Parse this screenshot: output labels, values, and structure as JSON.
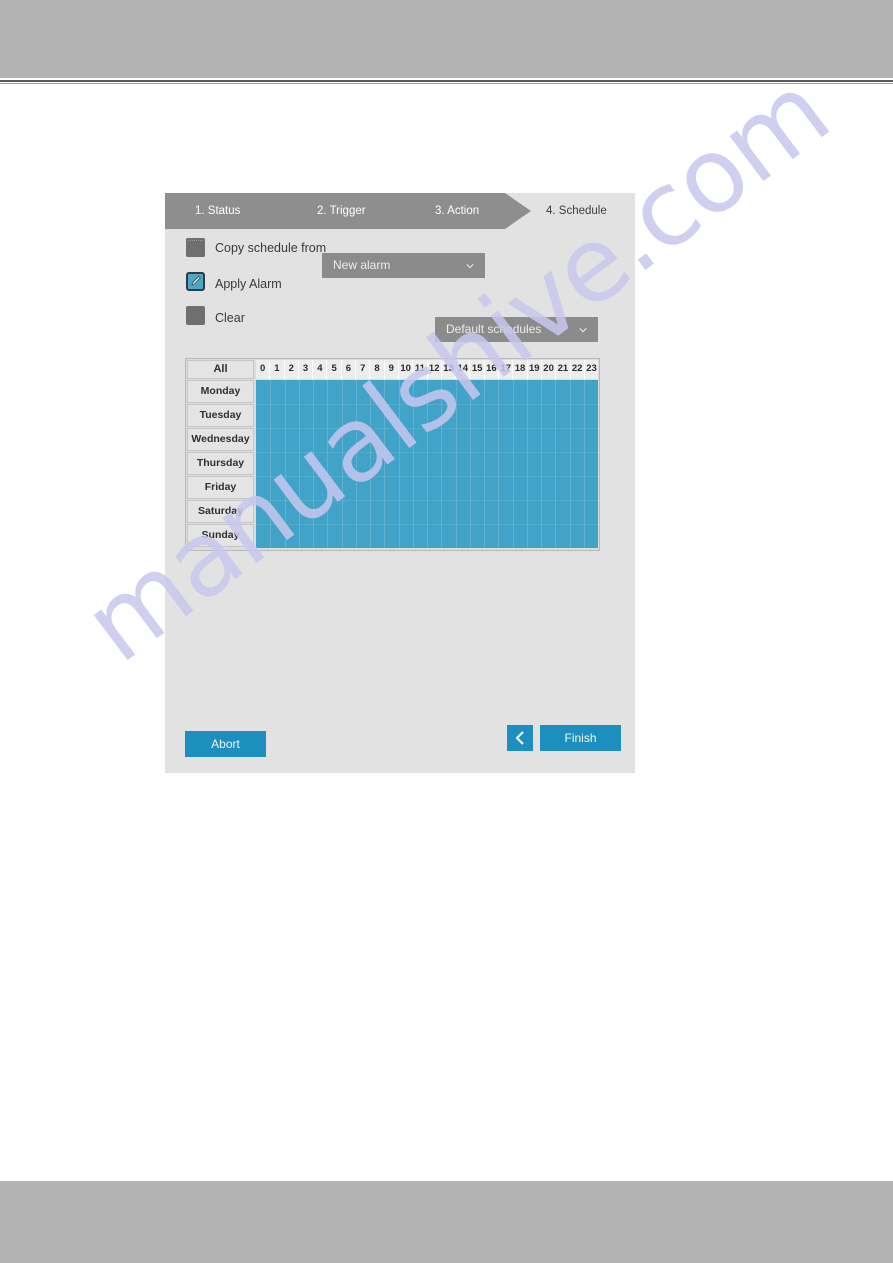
{
  "page": {
    "watermark": "manualshive.com"
  },
  "dialog": {
    "wizard_tabs": [
      {
        "label": "1. Status",
        "active": false
      },
      {
        "label": "2. Trigger",
        "active": false
      },
      {
        "label": "3. Action",
        "active": false
      },
      {
        "label": "4. Schedule",
        "active": true
      }
    ],
    "options": [
      {
        "label": "Copy schedule from",
        "icon": "square-unchecked-icon",
        "selected": false
      },
      {
        "label": "Apply Alarm",
        "icon": "pencil-icon",
        "selected": true
      },
      {
        "label": "Clear",
        "icon": "square-unchecked-icon",
        "selected": false
      }
    ],
    "dropdowns": {
      "copy_from": {
        "value": "New alarm",
        "icon": "chevron-down-icon"
      },
      "schedules": {
        "value": "Default schedules",
        "icon": "chevron-down-icon"
      }
    },
    "schedule": {
      "all_label": "All",
      "hours": [
        "0",
        "1",
        "2",
        "3",
        "4",
        "5",
        "6",
        "7",
        "8",
        "9",
        "10",
        "11",
        "12",
        "13",
        "14",
        "15",
        "16",
        "17",
        "18",
        "19",
        "20",
        "21",
        "22",
        "23"
      ],
      "days": [
        "Monday",
        "Tuesday",
        "Wednesday",
        "Thursday",
        "Friday",
        "Saturday",
        "Sunday"
      ],
      "filled": "all",
      "fill_color": "#41a3c7"
    },
    "footer": {
      "abort_label": "Abort",
      "finish_label": "Finish",
      "back_icon": "chevron-left-icon"
    },
    "colors": {
      "accent": "#1d8fbf",
      "schedule_fill": "#41a3c7",
      "ribbon": "#8e8e8e",
      "panel": "#e2e2e2"
    }
  }
}
